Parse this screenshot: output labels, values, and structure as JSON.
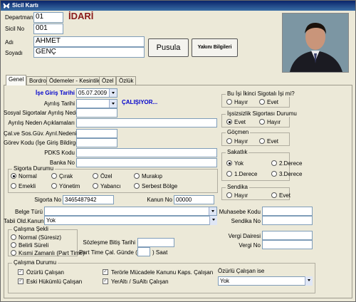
{
  "window": {
    "title": "Sicil Kartı"
  },
  "header": {
    "departman_label": "Departman",
    "departman_value": "01",
    "departman_name": "İDARİ",
    "sicil_label": "Sicil No",
    "sicil_value": "001",
    "adi_label": "Adı",
    "adi_value": "AHMET",
    "soyadi_label": "Soyadı",
    "soyadi_value": "GENÇ",
    "pusula_button": "Pusula",
    "yakini_button": "Yakını Bilgileri"
  },
  "tabs": [
    "Genel",
    "Bordro",
    "Ödemeler - Kesintiler",
    "Özel",
    "Özlük"
  ],
  "genel": {
    "ise_giris_label": "İşe Giriş Tarihi",
    "ise_giris_value": "05.07.2009",
    "ayrilis_label": "Ayrılış Tarihi",
    "status": "ÇALIŞIYOR...",
    "ayrilis_nedeni_label": "Sosyal Sigortalar Ayrılış Nedeni",
    "ayrilis_aciklama_label": "Ayrılış Neden Açıklamaları",
    "cal_ve_sos_label": "Çal.ve Sos.Güv. Ayrıl.Nedeni",
    "gorev_kodu_label": "Görev Kodu (İşe Giriş Bildirge.)",
    "pdks_label": "PDKS Kodu",
    "banka_label": "Banka No",
    "sigorta_durumu": {
      "legend": "Sigorta Durumu",
      "options": [
        "Normal",
        "Çırak",
        "Özel",
        "Murakıp",
        "Emekli",
        "Yönetim",
        "Yabancı",
        "Serbest Bölge"
      ],
      "selected": "Normal"
    },
    "sigorta_no_label": "Sigorta No",
    "sigorta_no_value": "3465487942",
    "kanun_no_label": "Kanun No",
    "kanun_no_value": "00000",
    "belge_turu_label": "Belge Türü",
    "tabii_label": "Tabii Old.Kanun",
    "tabii_value": "Yok",
    "calisma_sekli": {
      "legend": "Çalışma Şekli",
      "options": [
        "Normal (Süresiz)",
        "Belirli Süreli",
        "Kısmi Zamanlı (Part Time)"
      ],
      "selected": ""
    },
    "sozlesme_label": "Sözleşme Bitiş Tarihi",
    "part_time_label": "Part Time Çal. Günde (",
    "part_time_suffix": ") Saat",
    "right": {
      "ikinci_sigorta": {
        "legend": "Bu İşi İkinci Sigotalı İşi mi?",
        "options": [
          "Hayır",
          "Evet"
        ],
        "selected": ""
      },
      "issizlik": {
        "legend": "İşsizsizlik Sigortası Durumu",
        "options": [
          "Evet",
          "Hayır"
        ],
        "selected": "Evet"
      },
      "gocmen": {
        "legend": "Göçmen",
        "options": [
          "Hayır",
          "Evet"
        ],
        "selected": ""
      },
      "sakatlik": {
        "legend": "Sakatlık",
        "options": [
          "Yok",
          "2.Derece",
          "1.Derece",
          "3.Derece"
        ],
        "selected": "Yok"
      },
      "sendika": {
        "legend": "Sendika",
        "options": [
          "Hayır",
          "Evet"
        ],
        "selected": ""
      },
      "muhasebe_label": "Muhasebe Kodu",
      "sendika_no_label": "Sendika No",
      "vergi_dairesi_label": "Vergi Dairesi",
      "vergi_no_label": "Vergi No"
    },
    "calisma_durumu": {
      "legend": "Çalışma Durumu",
      "checks": [
        "Özürlü Çalışan",
        "Eski Hükümlü Çalışan",
        "Terörle Mücadele Kanunu Kaps. Çalışan",
        "YerAltı / SuAltı Çalışan"
      ],
      "ozurlu_ise_label": "Özürlü Çalışan ise",
      "ozurlu_ise_value": "Yok"
    }
  },
  "colors": {
    "accent_red": "#8b1a1a",
    "status_blue": "#0000cc",
    "title_bar": "#0a246a"
  }
}
